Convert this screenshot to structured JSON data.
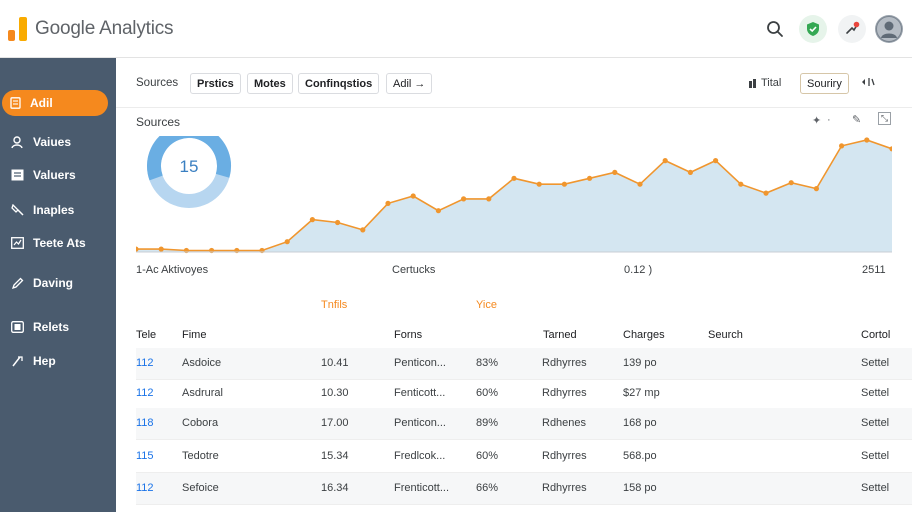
{
  "app": {
    "title": "Google Analytics",
    "brand_color": "#f5891e"
  },
  "topbar": {
    "icons": [
      {
        "name": "search-icon"
      },
      {
        "name": "shield-check-icon",
        "color": "#34a853"
      },
      {
        "name": "notifications-icon",
        "color": "#e8453c"
      },
      {
        "name": "account-avatar"
      }
    ]
  },
  "sidebar": {
    "bg_color": "#4a5b6e",
    "items": [
      {
        "label": "Adil",
        "icon": "document-icon",
        "active": true
      },
      {
        "label": "Vaiues",
        "icon": "person-icon"
      },
      {
        "label": "Valuers",
        "icon": "list-icon"
      },
      {
        "label": "Inaples",
        "icon": "tag-icon"
      },
      {
        "label": "Teete Ats",
        "icon": "chart-icon"
      },
      {
        "label": "Daving",
        "icon": "pen-icon"
      },
      {
        "label": "Relets",
        "icon": "doc-stack-icon"
      },
      {
        "label": "Hep",
        "icon": "help-icon"
      }
    ]
  },
  "tabs": {
    "sources": "Sources",
    "buttons": [
      "Prstics",
      "Motes",
      "Confinqstios",
      "Adil →"
    ],
    "total": "Tital",
    "security": "Souriry"
  },
  "chart_section": {
    "title": "Sources"
  },
  "chart_data": {
    "type": "area",
    "donut": {
      "value": "15",
      "fraction": 0.6
    },
    "series": [
      {
        "values": [
          2,
          2,
          1,
          1,
          1,
          1,
          7,
          22,
          20,
          15,
          33,
          38,
          28,
          36,
          36,
          50,
          46,
          46,
          50,
          54,
          46,
          62,
          54,
          62,
          46,
          40,
          47,
          43,
          72,
          76,
          70
        ]
      }
    ],
    "x_tick_labels": [
      "1-Ac Aktivoyes",
      "Certucks",
      "0.12 )",
      "2511"
    ],
    "legend": [
      "Tnfils",
      "Yice"
    ],
    "line_color": "#f0962e",
    "fill_color": "#d4e6f1"
  },
  "table": {
    "headers": [
      "Tele",
      "Fime",
      "Forns",
      "Tarned",
      "Charges",
      "Seurch",
      "Cortol"
    ],
    "rows": [
      {
        "id": "112",
        "name": "Asdoice",
        "value": "10.41",
        "form": "Penticon...",
        "pct": "83%",
        "type": "Rdhyrres",
        "charge": "139 po",
        "action": "Settel"
      },
      {
        "id": "112",
        "name": "Asdrural",
        "value": "10.30",
        "form": "Fenticott...",
        "pct": "60%",
        "type": "Rdhyrres",
        "charge": "$27 mp",
        "action": "Settel"
      },
      {
        "id": "118",
        "name": "Cobora",
        "value": "17.00",
        "form": "Penticon...",
        "pct": "89%",
        "type": "Rdhenes",
        "charge": "168 po",
        "action": "Settel"
      },
      {
        "id": "115",
        "name": "Tedotre",
        "value": "15.34",
        "form": "Fredlcok...",
        "pct": "60%",
        "type": "Rdhyrres",
        "charge": "568.po",
        "action": "Settel"
      },
      {
        "id": "112",
        "name": "Sefoice",
        "value": "16.34",
        "form": "Frenticott...",
        "pct": "66%",
        "type": "Rdhyrres",
        "charge": "158 po",
        "action": "Settel"
      }
    ]
  }
}
